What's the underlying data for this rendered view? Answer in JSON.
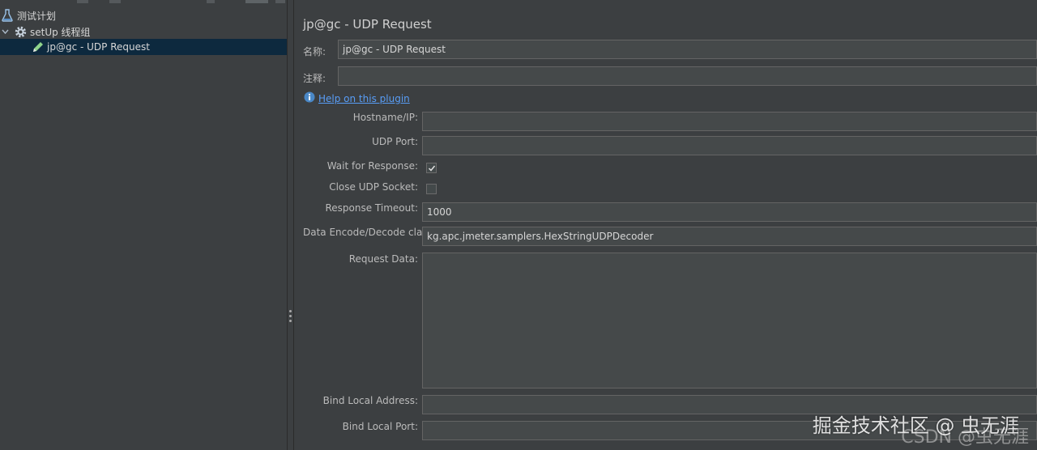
{
  "tree": {
    "items": [
      {
        "label": "测试计划",
        "icon": "flask-icon"
      },
      {
        "label": "setUp 线程组",
        "icon": "gear-icon"
      },
      {
        "label": "jp@gc - UDP Request",
        "icon": "pencil-icon"
      }
    ]
  },
  "panel": {
    "title": "jp@gc - UDP Request",
    "name_label": "名称:",
    "name_value": "jp@gc - UDP Request",
    "comment_label": "注释:",
    "comment_value": "",
    "help_link": "Help on this plugin",
    "hostname_label": "Hostname/IP:",
    "hostname_value": "",
    "port_label": "UDP Port:",
    "port_value": "",
    "wait_label": "Wait for Response:",
    "wait_checked": true,
    "close_label": "Close UDP Socket:",
    "close_checked": false,
    "timeout_label": "Response Timeout:",
    "timeout_value": "1000",
    "encode_label": "Data Encode/Decode class:",
    "encode_value": "kg.apc.jmeter.samplers.HexStringUDPDecoder",
    "request_label": "Request Data:",
    "request_value": "",
    "bind_addr_label": "Bind Local Address:",
    "bind_addr_value": "",
    "bind_port_label": "Bind Local Port:",
    "bind_port_value": ""
  },
  "watermark": {
    "text": "掘金技术社区 @ 虫无涯",
    "sub": "CSDN @虫无涯"
  },
  "colors": {
    "background": "#3c3f41",
    "field": "#45494a",
    "selection": "#0d293e",
    "link": "#589df6"
  }
}
